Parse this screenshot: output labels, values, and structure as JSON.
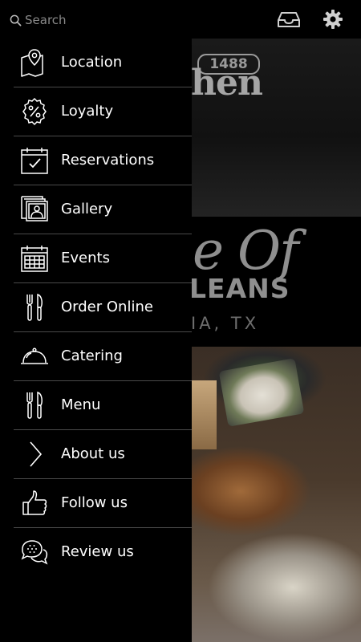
{
  "search": {
    "placeholder": "Search"
  },
  "background": {
    "logo_badge": "1488",
    "logo_word": "hen",
    "script_text": "e Of",
    "orleans_text": "LEANS",
    "city_text": "IA, TX"
  },
  "menu": {
    "items": [
      {
        "label": "Location",
        "icon": "map-pin-icon"
      },
      {
        "label": "Loyalty",
        "icon": "percent-badge-icon"
      },
      {
        "label": "Reservations",
        "icon": "calendar-check-icon"
      },
      {
        "label": "Gallery",
        "icon": "photo-stack-icon"
      },
      {
        "label": "Events",
        "icon": "calendar-grid-icon"
      },
      {
        "label": "Order Online",
        "icon": "fork-knife-icon"
      },
      {
        "label": "Catering",
        "icon": "cloche-icon"
      },
      {
        "label": "Menu",
        "icon": "fork-knife-icon"
      },
      {
        "label": "About us",
        "icon": "chevron-right-icon"
      },
      {
        "label": "Follow us",
        "icon": "thumbs-up-icon"
      },
      {
        "label": "Review us",
        "icon": "chat-bubbles-icon"
      }
    ]
  },
  "colors": {
    "background": "#000000",
    "text": "#ffffff",
    "divider": "#4a4a4a",
    "muted": "#8a8a8a"
  }
}
